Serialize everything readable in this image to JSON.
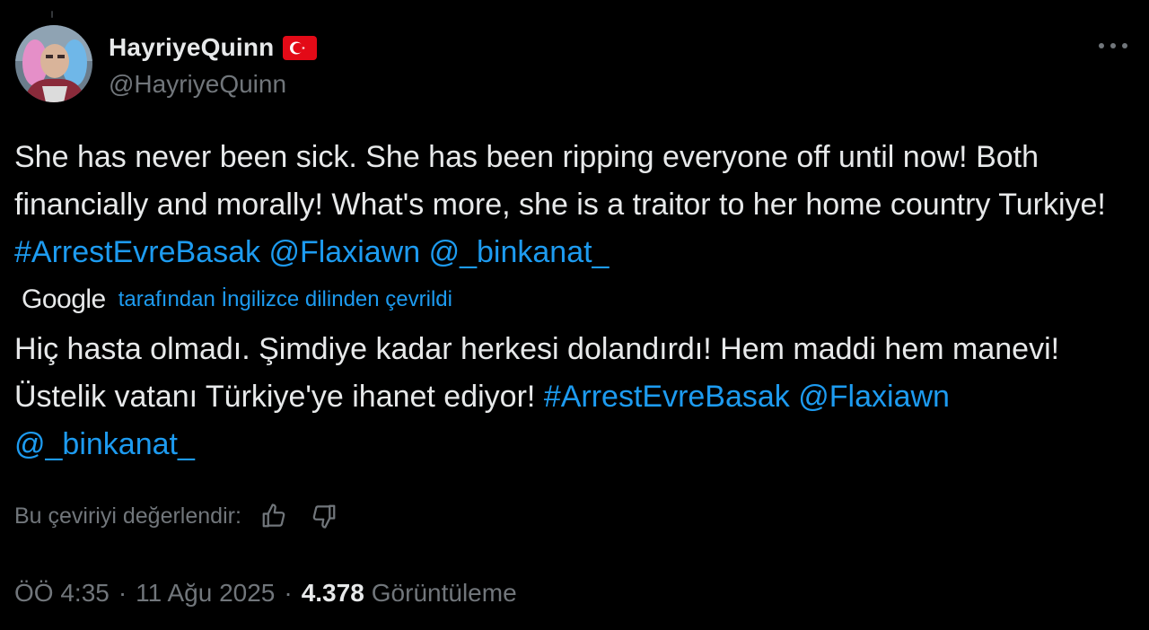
{
  "author": {
    "display_name": "HayriyeQuinn",
    "handle": "@HayriyeQuinn",
    "flag_icon": "turkey-flag-icon",
    "avatar_icon": "profile-photo"
  },
  "tweet": {
    "text_segments": {
      "plain": "She has never been sick. She has been ripping everyone off until now! Both financially and morally! What's more, she is a traitor to her home country Turkiye!",
      "hashtag": "#ArrestEvreBasak",
      "mention_1": "@Flaxiawn",
      "mention_2": "@_binkanat_"
    }
  },
  "translation": {
    "provider": "Google",
    "note": "tarafından İngilizce dilinden çevrildi",
    "text_segments": {
      "plain": "Hiç hasta olmadı. Şimdiye kadar herkesi dolandırdı! Hem maddi hem manevi! Üstelik vatanı Türkiye'ye ihanet ediyor!",
      "hashtag": "#ArrestEvreBasak",
      "mention_1": "@Flaxiawn",
      "mention_2": "@_binkanat_"
    }
  },
  "rating": {
    "label": "Bu çeviriyi değerlendir:",
    "thumbs_up_icon": "thumbs-up-icon",
    "thumbs_down_icon": "thumbs-down-icon"
  },
  "meta": {
    "time": "ÖÖ 4:35",
    "separator": "·",
    "date": "11 Ağu 2025",
    "views_count": "4.378",
    "views_label": "Görüntüleme"
  },
  "colors": {
    "background": "#000000",
    "text": "#e7e9ea",
    "secondary": "#71767b",
    "link": "#1d9bf0"
  }
}
